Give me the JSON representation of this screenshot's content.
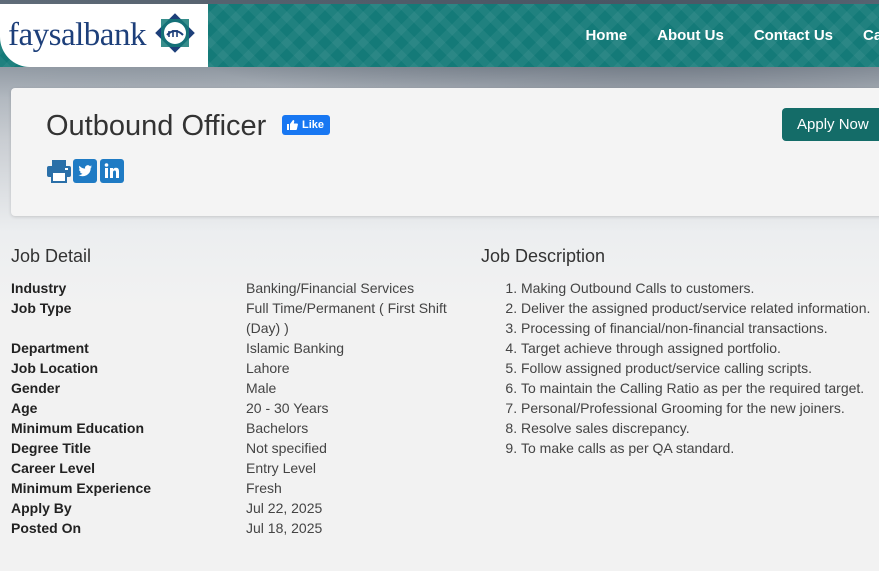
{
  "header": {
    "logo_text": "faysalbank",
    "nav": [
      {
        "label": "Home"
      },
      {
        "label": "About Us"
      },
      {
        "label": "Contact Us"
      },
      {
        "label": "Ca"
      }
    ]
  },
  "job": {
    "title": "Outbound Officer",
    "like_label": "Like",
    "apply_label": "Apply Now",
    "share_icons": [
      "print-icon",
      "twitter-icon",
      "linkedin-icon"
    ]
  },
  "detail": {
    "heading": "Job Detail",
    "rows": [
      {
        "key": "Industry",
        "value": "Banking/Financial Services"
      },
      {
        "key": "Job Type",
        "value": "Full Time/Permanent ( First Shift (Day) )"
      },
      {
        "key": "Department",
        "value": "Islamic Banking"
      },
      {
        "key": "Job Location",
        "value": "Lahore"
      },
      {
        "key": "Gender",
        "value": "Male"
      },
      {
        "key": "Age",
        "value": "20 - 30 Years"
      },
      {
        "key": "Minimum Education",
        "value": "Bachelors"
      },
      {
        "key": "Degree Title",
        "value": "Not specified"
      },
      {
        "key": "Career Level",
        "value": "Entry Level"
      },
      {
        "key": "Minimum Experience",
        "value": "Fresh"
      },
      {
        "key": "Apply By",
        "value": "Jul 22, 2025"
      },
      {
        "key": "Posted On",
        "value": "Jul 18, 2025"
      }
    ]
  },
  "description": {
    "heading": "Job Description",
    "items": [
      "Making Outbound Calls to customers.",
      "Deliver the assigned product/service related information.",
      "Processing of financial/non-financial transactions.",
      "Target achieve through assigned portfolio.",
      "Follow assigned product/service calling scripts.",
      "To maintain the Calling Ratio as per the required target.",
      "Personal/Professional Grooming for the new joiners.",
      "Resolve sales discrepancy.",
      "To make calls as per QA standard."
    ]
  },
  "colors": {
    "header_teal": "#147a78",
    "button_teal": "#146c68",
    "logo_blue": "#1d3f7a",
    "facebook_blue": "#1877f2",
    "share_blue": "#1f7bc4"
  }
}
